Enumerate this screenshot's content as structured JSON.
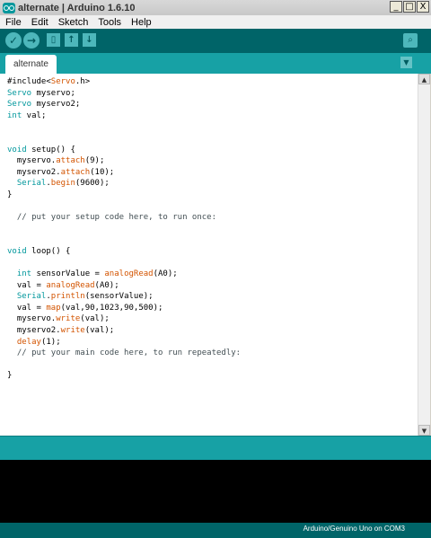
{
  "window": {
    "title": "alternate | Arduino 1.6.10",
    "controls": {
      "minimize": "_",
      "maximize": "□",
      "close": "X"
    }
  },
  "menu": [
    "File",
    "Edit",
    "Sketch",
    "Tools",
    "Help"
  ],
  "toolbar": {
    "buttons": [
      {
        "name": "verify",
        "icon": "check-icon",
        "glyph": "✓"
      },
      {
        "name": "upload",
        "icon": "arrow-right-icon",
        "glyph": "→"
      },
      {
        "name": "new",
        "icon": "new-file-icon",
        "glyph": "▯"
      },
      {
        "name": "open",
        "icon": "arrow-up-icon",
        "glyph": "↑"
      },
      {
        "name": "save",
        "icon": "arrow-down-icon",
        "glyph": "↓"
      }
    ],
    "serial_monitor": {
      "icon": "magnifier-icon",
      "glyph": "⌕"
    }
  },
  "tabs": [
    {
      "label": "alternate"
    }
  ],
  "tab_menu_glyph": "▼",
  "code_lines": [
    "#include<Servo.h>",
    "Servo myservo;",
    "Servo myservo2;",
    "int val;",
    "",
    "",
    "void setup() {",
    "  myservo.attach(9);",
    "  myservo2.attach(10);",
    "  Serial.begin(9600);",
    "}",
    "",
    "  // put your setup code here, to run once:",
    "",
    "",
    "void loop() {",
    "",
    "  int sensorValue = analogRead(A0);",
    "  val = analogRead(A0);",
    "  Serial.println(sensorValue);",
    "  val = map(val,90,1023,90,500);",
    "  myservo.write(val);",
    "  myservo2.write(val);",
    "  delay(1);",
    "  // put your main code here, to run repeatedly:",
    "",
    "}"
  ],
  "status": {
    "board": "Arduino/Genuino Uno on COM3"
  },
  "colors": {
    "teal_dark": "#006468",
    "teal": "#17a1a5",
    "keyword": "#00979c",
    "function": "#d35400",
    "comment": "#434f54"
  }
}
